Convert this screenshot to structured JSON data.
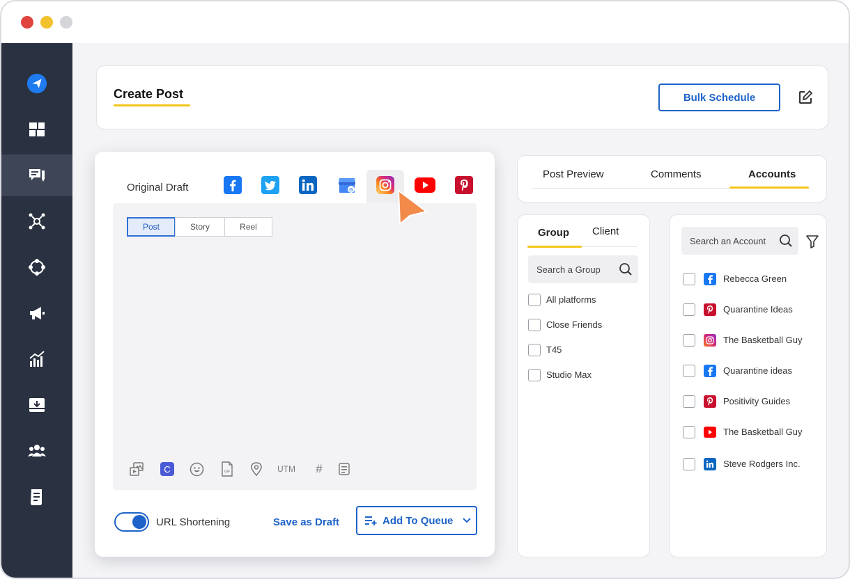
{
  "header": {
    "title": "Create Post",
    "bulk_schedule_label": "Bulk Schedule"
  },
  "sidebar": {
    "items": [
      {
        "name": "logo",
        "icon": "paper-plane-icon"
      },
      {
        "name": "dashboard",
        "icon": "dashboard-icon"
      },
      {
        "name": "compose",
        "icon": "compose-icon",
        "active": true
      },
      {
        "name": "network",
        "icon": "network-icon"
      },
      {
        "name": "workflow",
        "icon": "workflow-icon"
      },
      {
        "name": "campaigns",
        "icon": "megaphone-icon"
      },
      {
        "name": "analytics",
        "icon": "analytics-icon"
      },
      {
        "name": "inbox",
        "icon": "inbox-icon"
      },
      {
        "name": "team",
        "icon": "team-icon"
      },
      {
        "name": "reports",
        "icon": "reports-icon"
      }
    ]
  },
  "editor": {
    "original_draft_label": "Original Draft",
    "platforms": [
      "facebook",
      "twitter",
      "linkedin",
      "google-business",
      "instagram",
      "youtube",
      "pinterest"
    ],
    "selected_platform": "instagram",
    "post_types": [
      "Post",
      "Story",
      "Reel"
    ],
    "selected_post_type": "Post",
    "toolbar": {
      "utm_label": "UTM",
      "hashtag_label": "#"
    },
    "url_shortening_label": "URL Shortening",
    "url_shortening_on": true,
    "save_draft_label": "Save as Draft",
    "add_queue_label": "Add To Queue"
  },
  "right_tabs": {
    "tabs": [
      "Post Preview",
      "Comments",
      "Accounts"
    ],
    "active": "Accounts"
  },
  "groups_panel": {
    "tabs": [
      "Group",
      "Client"
    ],
    "active": "Group",
    "search_placeholder": "Search a Group",
    "items": [
      "All platforms",
      "Close Friends",
      "T45",
      "Studio Max"
    ]
  },
  "accounts_panel": {
    "search_placeholder": "Search an Account",
    "accounts": [
      {
        "name": "Rebecca Green",
        "platform": "facebook"
      },
      {
        "name": "Quarantine Ideas",
        "platform": "pinterest"
      },
      {
        "name": "The Basketball Guy",
        "platform": "instagram"
      },
      {
        "name": "Quarantine ideas",
        "platform": "facebook"
      },
      {
        "name": "Positivity Guides",
        "platform": "pinterest"
      },
      {
        "name": "The Basketball Guy",
        "platform": "youtube"
      },
      {
        "name": "Steve Rodgers Inc.",
        "platform": "linkedin"
      }
    ]
  },
  "colors": {
    "accent_blue": "#1e63c9",
    "accent_yellow": "#f5c518",
    "sidebar_bg": "#2a3140",
    "cursor_orange": "#f28a4a"
  }
}
